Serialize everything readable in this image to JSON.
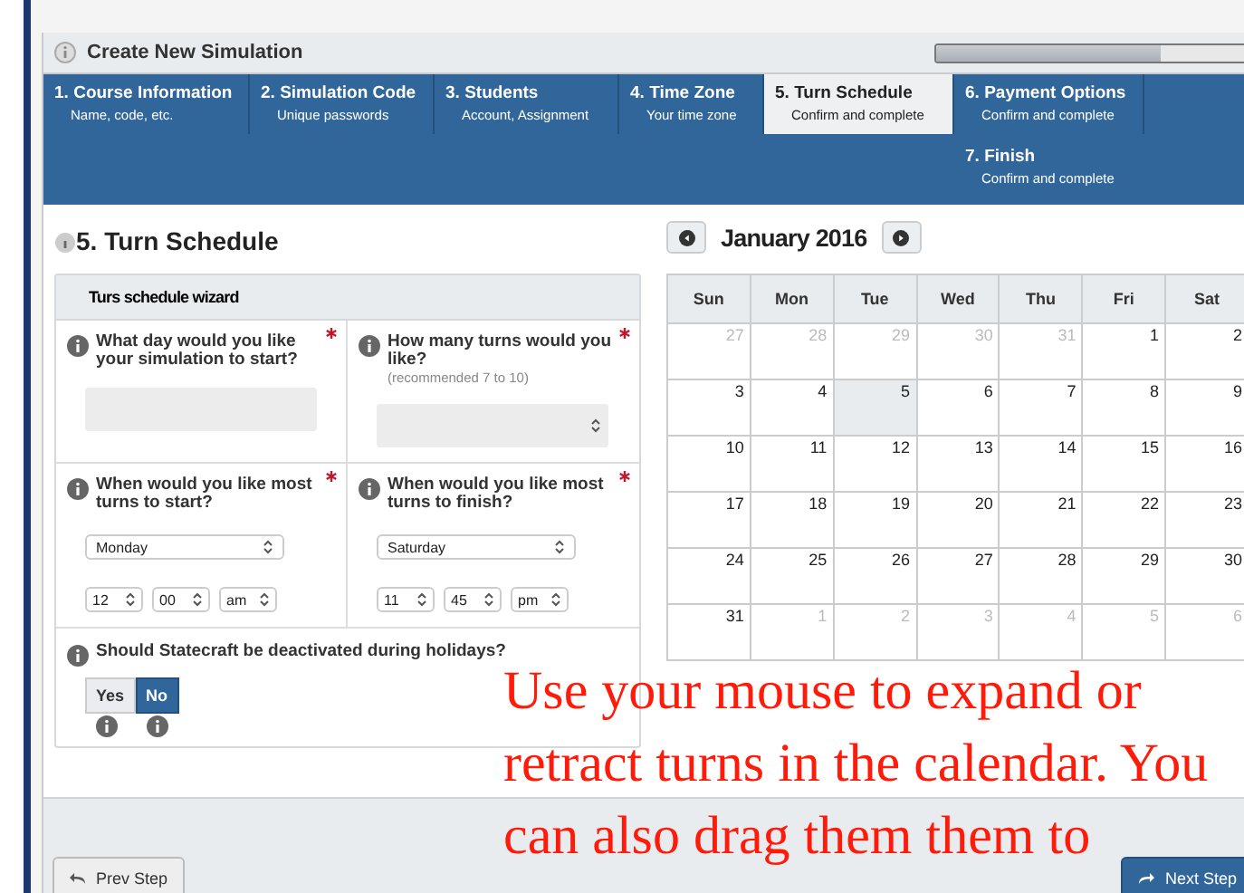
{
  "header": {
    "title": "Create New Simulation",
    "progress": {
      "level": 0.72
    }
  },
  "steps": [
    {
      "number": "1.",
      "title": "Course Information",
      "subtitle": "Name, code, etc.",
      "selected": false
    },
    {
      "number": "2.",
      "title": "Simulation Code",
      "subtitle": "Unique passwords",
      "selected": false
    },
    {
      "number": "3.",
      "title": "Students",
      "subtitle": "Account, Assignment",
      "selected": false
    },
    {
      "number": "4.",
      "title": "Time Zone",
      "subtitle": "Your time zone",
      "selected": false
    },
    {
      "number": "5.",
      "title": "Turn Schedule",
      "subtitle": "Confirm and complete",
      "selected": true
    },
    {
      "number": "6.",
      "title": "Payment Options",
      "subtitle": "Confirm and complete",
      "selected": false
    },
    {
      "number": "7.",
      "title": "Finish",
      "subtitle": "Confirm and complete",
      "selected": false
    }
  ],
  "section_title": "5. Turn Schedule",
  "wizard": {
    "title": "Turs schedule wizard",
    "questions": [
      {
        "kind": "text",
        "question": "What day would you like your simulation to start?",
        "required": true
      },
      {
        "kind": "number",
        "question": "How many turns would you like?",
        "hint": "(recommended 7 to 10)",
        "required": true
      },
      {
        "kind": "time",
        "question": "When would you like most turns to start?",
        "required": true,
        "day": "Monday",
        "hour": "12",
        "minute": "00",
        "period": "am"
      },
      {
        "kind": "time",
        "question": "When would you like most turns to finish?",
        "required": true,
        "day": "Saturday",
        "hour": "11",
        "minute": "45",
        "period": "pm"
      }
    ],
    "holiday": {
      "question": "Should Statecraft be deactivated during holidays?",
      "options": [
        {
          "label": "Yes",
          "selected": false
        },
        {
          "label": "No",
          "selected": true
        }
      ]
    }
  },
  "calendar": {
    "month": "January 2016",
    "weekdays": [
      "Sun",
      "Mon",
      "Tue",
      "Wed",
      "Thu",
      "Fri",
      "Sat"
    ],
    "weeks": [
      [
        {
          "day": "27",
          "muted": true,
          "selected": false
        },
        {
          "day": "28",
          "muted": true,
          "selected": false
        },
        {
          "day": "29",
          "muted": true,
          "selected": false
        },
        {
          "day": "30",
          "muted": true,
          "selected": false
        },
        {
          "day": "31",
          "muted": true,
          "selected": false
        },
        {
          "day": "1",
          "muted": false,
          "selected": false
        },
        {
          "day": "2",
          "muted": false,
          "selected": false
        }
      ],
      [
        {
          "day": "3",
          "muted": false,
          "selected": false
        },
        {
          "day": "4",
          "muted": false,
          "selected": false
        },
        {
          "day": "5",
          "muted": false,
          "selected": true
        },
        {
          "day": "6",
          "muted": false,
          "selected": false
        },
        {
          "day": "7",
          "muted": false,
          "selected": false
        },
        {
          "day": "8",
          "muted": false,
          "selected": false
        },
        {
          "day": "9",
          "muted": false,
          "selected": false
        }
      ],
      [
        {
          "day": "10",
          "muted": false,
          "selected": false
        },
        {
          "day": "11",
          "muted": false,
          "selected": false
        },
        {
          "day": "12",
          "muted": false,
          "selected": false
        },
        {
          "day": "13",
          "muted": false,
          "selected": false
        },
        {
          "day": "14",
          "muted": false,
          "selected": false
        },
        {
          "day": "15",
          "muted": false,
          "selected": false
        },
        {
          "day": "16",
          "muted": false,
          "selected": false
        }
      ],
      [
        {
          "day": "17",
          "muted": false,
          "selected": false
        },
        {
          "day": "18",
          "muted": false,
          "selected": false
        },
        {
          "day": "19",
          "muted": false,
          "selected": false
        },
        {
          "day": "20",
          "muted": false,
          "selected": false
        },
        {
          "day": "21",
          "muted": false,
          "selected": false
        },
        {
          "day": "22",
          "muted": false,
          "selected": false
        },
        {
          "day": "23",
          "muted": false,
          "selected": false
        }
      ],
      [
        {
          "day": "24",
          "muted": false,
          "selected": false
        },
        {
          "day": "25",
          "muted": false,
          "selected": false
        },
        {
          "day": "26",
          "muted": false,
          "selected": false
        },
        {
          "day": "27",
          "muted": false,
          "selected": false
        },
        {
          "day": "28",
          "muted": false,
          "selected": false
        },
        {
          "day": "29",
          "muted": false,
          "selected": false
        },
        {
          "day": "30",
          "muted": false,
          "selected": false
        }
      ],
      [
        {
          "day": "31",
          "muted": false,
          "selected": false
        },
        {
          "day": "1",
          "muted": true,
          "selected": false
        },
        {
          "day": "2",
          "muted": true,
          "selected": false
        },
        {
          "day": "3",
          "muted": true,
          "selected": false
        },
        {
          "day": "4",
          "muted": true,
          "selected": false
        },
        {
          "day": "5",
          "muted": true,
          "selected": false
        },
        {
          "day": "6",
          "muted": true,
          "selected": false
        }
      ]
    ]
  },
  "annotation": "Use your mouse to expand or retract turns in the calendar. You can also drag them them to",
  "footer": {
    "prev": "Prev Step",
    "next": "Next Step"
  }
}
